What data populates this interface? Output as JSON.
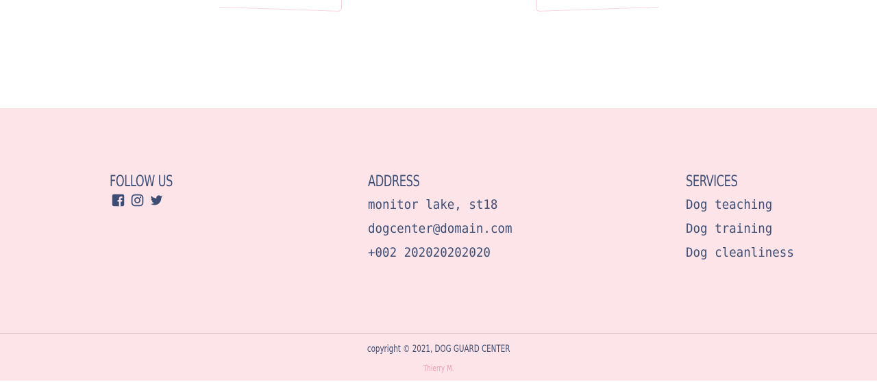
{
  "follow": {
    "heading": "FOLLOW US",
    "icons": [
      "facebook-icon",
      "instagram-icon",
      "twitter-icon"
    ]
  },
  "address": {
    "heading": "ADDRESS",
    "street": "monitor lake, st18",
    "email": "dogcenter@domain.com",
    "phone": "+002 202020202020"
  },
  "services": {
    "heading": "SERVICES",
    "items": [
      "Dog teaching",
      "Dog training",
      "Dog cleanliness"
    ]
  },
  "footer": {
    "copyright": "copyright © 2021, DOG GUARD CENTER",
    "author": "Thierry M."
  },
  "colors": {
    "footer_bg": "#fde4e8",
    "text": "#3e4d74",
    "author": "#e7a1b2"
  }
}
